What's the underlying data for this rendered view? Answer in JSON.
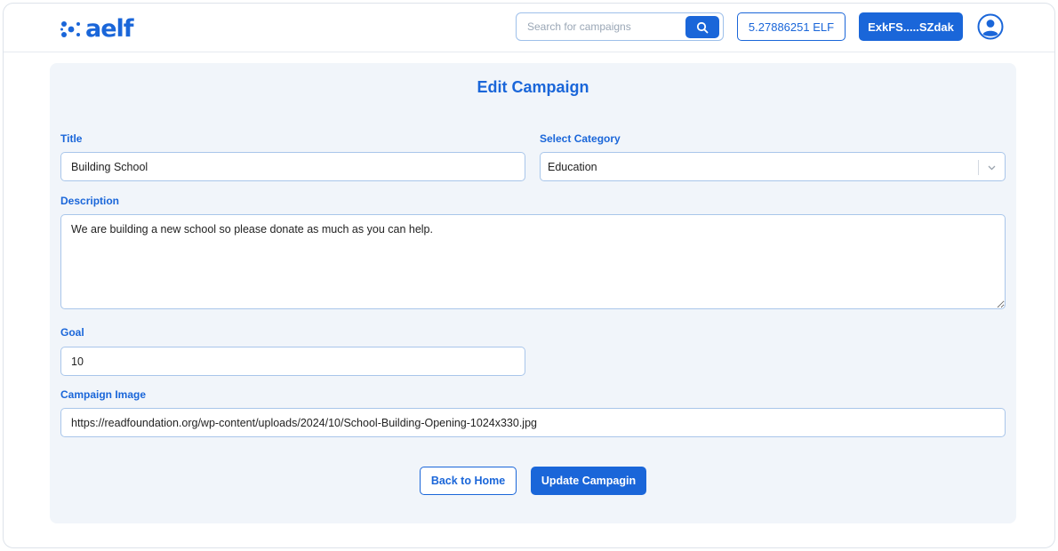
{
  "brand": {
    "name": "aelf",
    "color": "#1a66d9"
  },
  "header": {
    "search": {
      "placeholder": "Search for campaigns",
      "value": ""
    },
    "balance": "5.27886251 ELF",
    "wallet": "ExkFS.....SZdak",
    "icons": [
      "search-icon",
      "user-avatar-icon"
    ]
  },
  "form": {
    "title": "Edit Campaign",
    "title_label": "Title",
    "title_value": "Building School",
    "category_label": "Select Category",
    "category_value": "Education",
    "description_label": "Description",
    "description_value": "We are building a new school so please donate as much as you can help.",
    "goal_label": "Goal",
    "goal_value": "10",
    "image_label": "Campaign Image",
    "image_value": "https://readfoundation.org/wp-content/uploads/2024/10/School-Building-Opening-1024x330.jpg"
  },
  "actions": {
    "back": "Back to Home",
    "update": "Update Campagin"
  }
}
